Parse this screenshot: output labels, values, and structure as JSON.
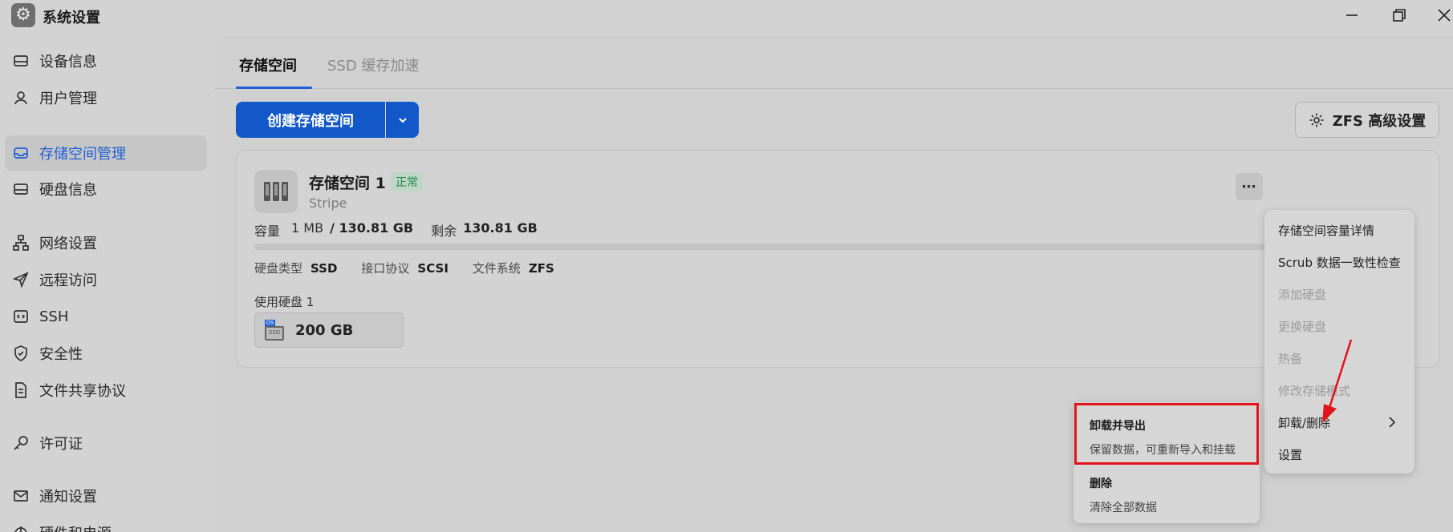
{
  "window": {
    "title": "系统设置",
    "minimize_icon": "minimize-icon",
    "maximize_icon": "maximize-icon",
    "close_icon": "close-icon"
  },
  "sidebar": {
    "items": [
      {
        "label": "设备信息",
        "icon": "device-icon"
      },
      {
        "label": "用户管理",
        "icon": "user-icon"
      },
      {
        "label": "存储空间管理",
        "icon": "storage-icon",
        "active": true
      },
      {
        "label": "硬盘信息",
        "icon": "disk-icon"
      },
      {
        "label": "网络设置",
        "icon": "network-icon"
      },
      {
        "label": "远程访问",
        "icon": "send-icon"
      },
      {
        "label": "SSH",
        "icon": "terminal-icon"
      },
      {
        "label": "安全性",
        "icon": "shield-icon"
      },
      {
        "label": "文件共享协议",
        "icon": "document-icon"
      },
      {
        "label": "许可证",
        "icon": "key-icon"
      },
      {
        "label": "通知设置",
        "icon": "mail-icon"
      },
      {
        "label": "硬件和电源",
        "icon": "power-icon"
      }
    ]
  },
  "tabs": {
    "active": "存储空间",
    "inactive": "SSD 缓存加速"
  },
  "toolbar": {
    "create_label": "创建存储空间",
    "zfs_label": "ZFS 高级设置"
  },
  "pool": {
    "name": "存储空间 1",
    "status": "正常",
    "type": "Stripe",
    "capacity_label": "容量",
    "used": "1 MB",
    "total": "/ 130.81 GB",
    "remaining_label": "剩余",
    "remaining": "130.81 GB",
    "used_fraction": 0.0,
    "disk_type_label": "硬盘类型",
    "disk_type": "SSD",
    "interface_label": "接口协议",
    "interface": "SCSI",
    "fs_label": "文件系统",
    "fs": "ZFS",
    "disks_label": "使用硬盘 1",
    "disk_size": "200 GB",
    "disk_badge": "OS",
    "disk_chip_label": "SSD"
  },
  "menu": {
    "items": [
      {
        "label": "存储空间容量详情",
        "disabled": false
      },
      {
        "label": "Scrub 数据一致性检查",
        "disabled": false
      },
      {
        "label": "添加硬盘",
        "disabled": true
      },
      {
        "label": "更换硬盘",
        "disabled": true
      },
      {
        "label": "热备",
        "disabled": true
      },
      {
        "label": "修改存储模式",
        "disabled": true
      },
      {
        "label": "卸载/删除",
        "disabled": false,
        "submenu": true
      },
      {
        "label": "设置",
        "disabled": false
      }
    ]
  },
  "submenu": {
    "export_title": "卸载并导出",
    "export_desc": "保留数据，可重新导入和挂载",
    "delete_title": "删除",
    "delete_desc": "清除全部数据"
  },
  "colors": {
    "accent": "#1358c9",
    "status_green": "#1e8a46",
    "highlight_red": "#e0141a"
  }
}
